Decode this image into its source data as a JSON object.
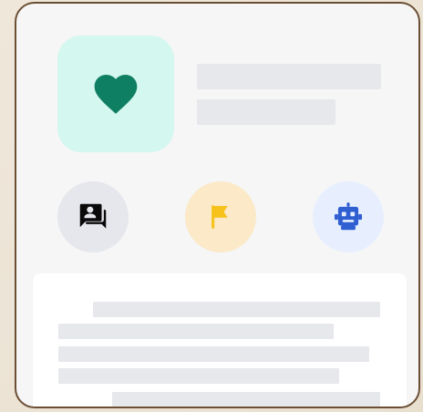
{
  "icons": {
    "hero": "heart-icon",
    "btn1": "contact-chat-icon",
    "btn2": "flag-icon",
    "btn3": "robot-icon"
  },
  "colors": {
    "background": "#ece4d6",
    "card_border": "#6b4f34",
    "card_fill": "#f6f6f6",
    "hero_bg": "#d4f7ef",
    "heart": "#0f7f63",
    "skeleton_bar": "#e7e8ec",
    "circle1_bg": "#e6e7ec",
    "circle2_bg": "#fbe9c8",
    "circle3_bg": "#e7efff",
    "flag": "#f6c21b",
    "robot": "#2f5fd0"
  }
}
